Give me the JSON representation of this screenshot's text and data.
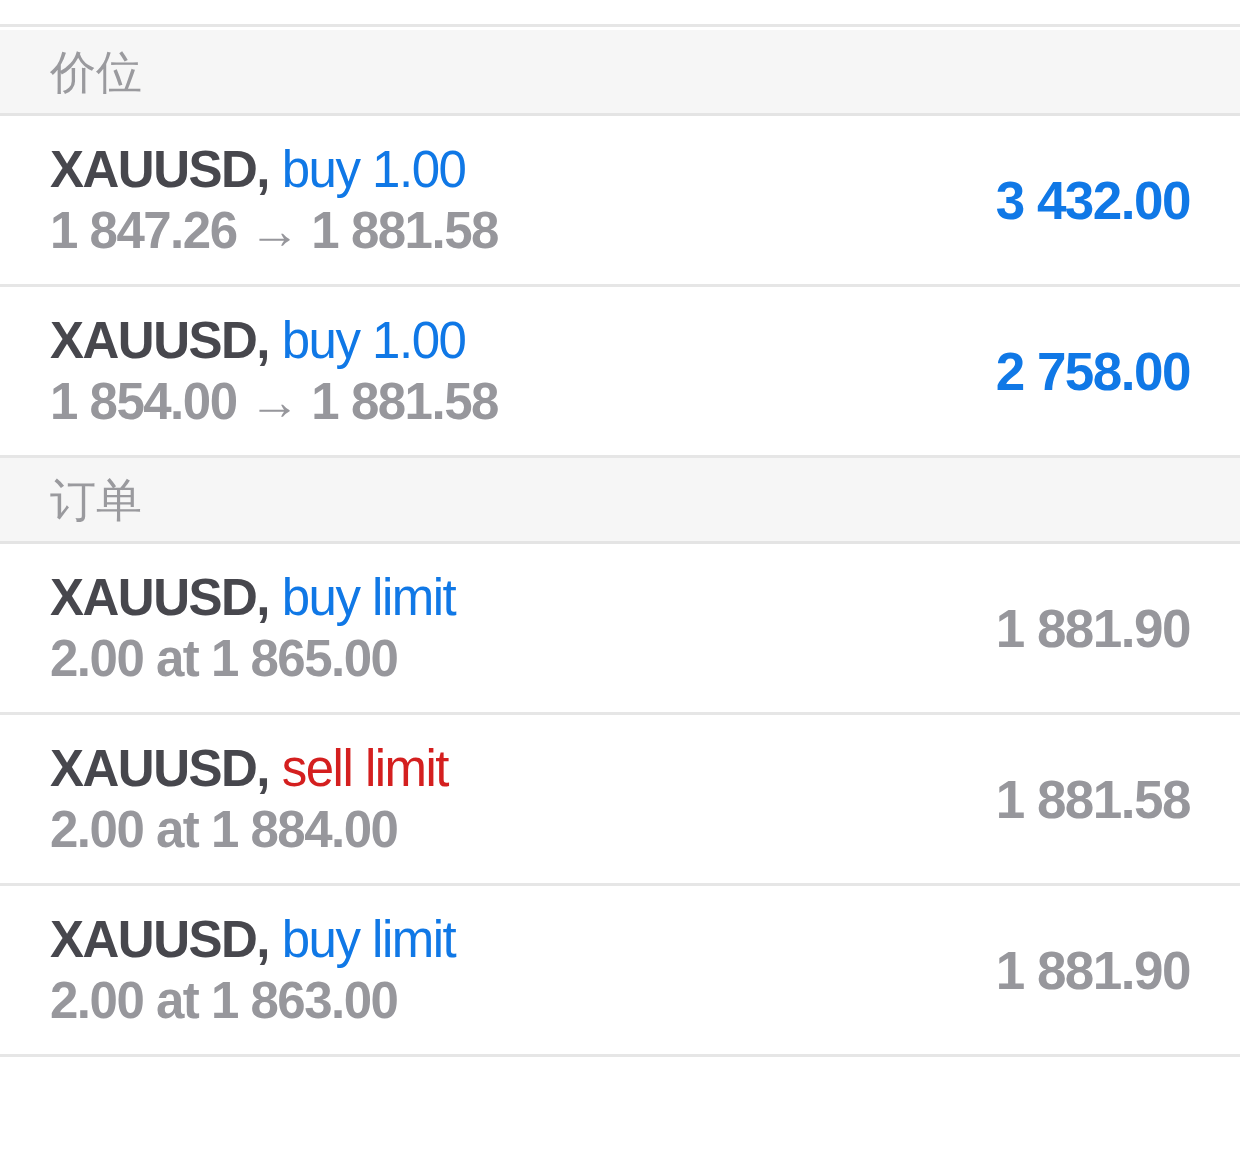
{
  "sections": [
    {
      "title": "价位",
      "items": [
        {
          "kind": "position",
          "symbol": "XAUUSD,",
          "side": "buy",
          "order": "1.00",
          "detail": "1 847.26 → 1 881.58",
          "value": "3 432.00"
        },
        {
          "kind": "position",
          "symbol": "XAUUSD,",
          "side": "buy",
          "order": "1.00",
          "detail": "1 854.00 → 1 881.58",
          "value": "2 758.00"
        }
      ]
    },
    {
      "title": "订单",
      "items": [
        {
          "kind": "order",
          "symbol": "XAUUSD,",
          "side": "buy",
          "order": "limit",
          "detail": "2.00 at 1 865.00",
          "value": "1 881.90"
        },
        {
          "kind": "order",
          "symbol": "XAUUSD,",
          "side": "sell",
          "order": "limit",
          "detail": "2.00 at 1 884.00",
          "value": "1 881.58"
        },
        {
          "kind": "order",
          "symbol": "XAUUSD,",
          "side": "buy",
          "order": "limit",
          "detail": "2.00 at 1 863.00",
          "value": "1 881.90"
        }
      ]
    }
  ]
}
